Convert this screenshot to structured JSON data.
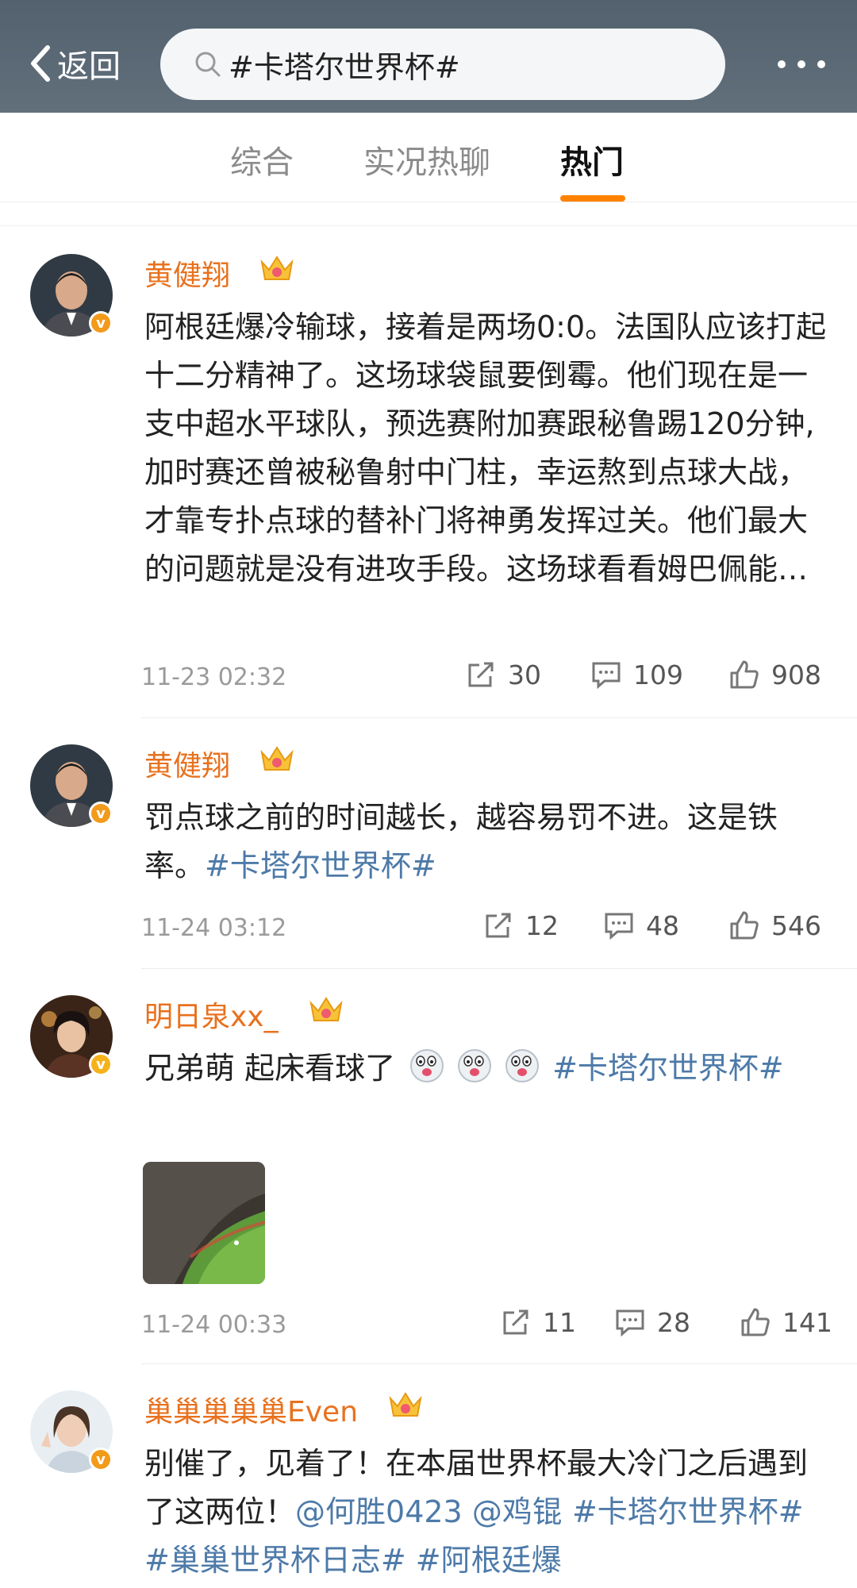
{
  "header": {
    "back_label": "返回",
    "search_query": "#卡塔尔世界杯#"
  },
  "tabs": [
    {
      "label": "综合",
      "active": false
    },
    {
      "label": "实况热聊",
      "active": false
    },
    {
      "label": "热门",
      "active": true
    }
  ],
  "accent_color": "#ff8200",
  "posts": [
    {
      "user": "黄健翔",
      "verified_badge": "v",
      "content": "阿根廷爆冷输球，接着是两场0:0。法国队应该打起十二分精神了。这场球袋鼠要倒霉。他们现在是一支中超水平球队，预选赛附加赛跟秘鲁踢120分钟,加时赛还曾被秘鲁射中门柱，幸运熬到点球大战，才靠专扑点球的替补门将神勇发挥过关。他们最大的问题就是没有进攻手段。这场球看看姆巴佩能…",
      "time": "11-23 02:32",
      "reposts": "30",
      "comments": "109",
      "likes": "908"
    },
    {
      "user": "黄健翔",
      "verified_badge": "v",
      "content": "罚点球之前的时间越长，越容易罚不进。这是铁率。",
      "tag": "#卡塔尔世界杯#",
      "time": "11-24 03:12",
      "reposts": "12",
      "comments": "48",
      "likes": "546"
    },
    {
      "user": "明日泉xx_",
      "verified_badge": "v",
      "content": "兄弟萌 起床看球了",
      "tag": "#卡塔尔世界杯#",
      "time": "11-24 00:33",
      "reposts": "11",
      "comments": "28",
      "likes": "141"
    },
    {
      "user": "巢巢巢巢巢Even",
      "verified_badge": "v",
      "content": "别催了，见着了！在本届世界杯最大冷门之后遇到了这两位！",
      "mentions": [
        "@何胜0423",
        "@鸡锟"
      ],
      "tags": [
        "#卡塔尔世界杯#",
        "#巢巢世界杯日志#",
        "#阿根廷爆"
      ]
    }
  ],
  "icons": {
    "back": "chevron-left-icon",
    "search": "search-icon",
    "more": "more-dots-icon",
    "repost": "repost-icon",
    "comment": "comment-icon",
    "like": "thumbs-up-icon",
    "member": "crown-icon"
  }
}
